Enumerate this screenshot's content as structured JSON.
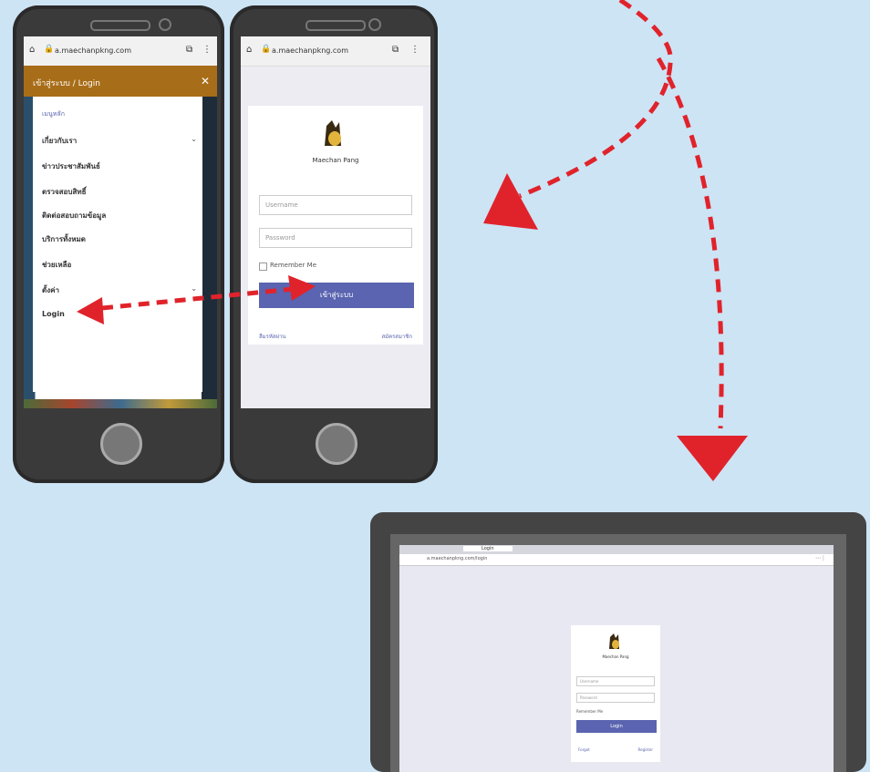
{
  "phone_left": {
    "url": "a.maechanpkng.com",
    "menu_header": "เข้าสู่ระบบ / Login",
    "menu_section": "เมนูหลัก",
    "menu_items": [
      "เกี่ยวกับเรา",
      "ข่าวประชาสัมพันธ์",
      "ตรวจสอบสิทธิ์ ",
      "ติดต่อสอบถามข้อมูล",
      "บริการทั้งหมด",
      "ช่วยเหลือ",
      "ตั้งค่า",
      "Login"
    ]
  },
  "phone_right": {
    "url": "a.maechanpkng.com",
    "app_name": "Maechan Pang",
    "username_placeholder": "Username",
    "password_placeholder": "Password",
    "remember_label": "Remember Me",
    "login_button": "เข้าสู่ระบบ",
    "link_left": "ลืมรหัสผ่าน",
    "link_right": "สมัครสมาชิก"
  },
  "desktop": {
    "browser_tab": "Login",
    "address": "a.maechanpkng.com/login",
    "app_name": "Maechan Pang",
    "username_placeholder": "Username",
    "password_placeholder": "Password",
    "remember_label": "Remember Me",
    "login_button": "Login",
    "link_left": "Forgot",
    "link_right": "Register"
  },
  "colors": {
    "background": "#cde4f5",
    "arrow": "#e0232b",
    "primary_button": "#5a64b0",
    "menu_header": "#a86d18"
  }
}
